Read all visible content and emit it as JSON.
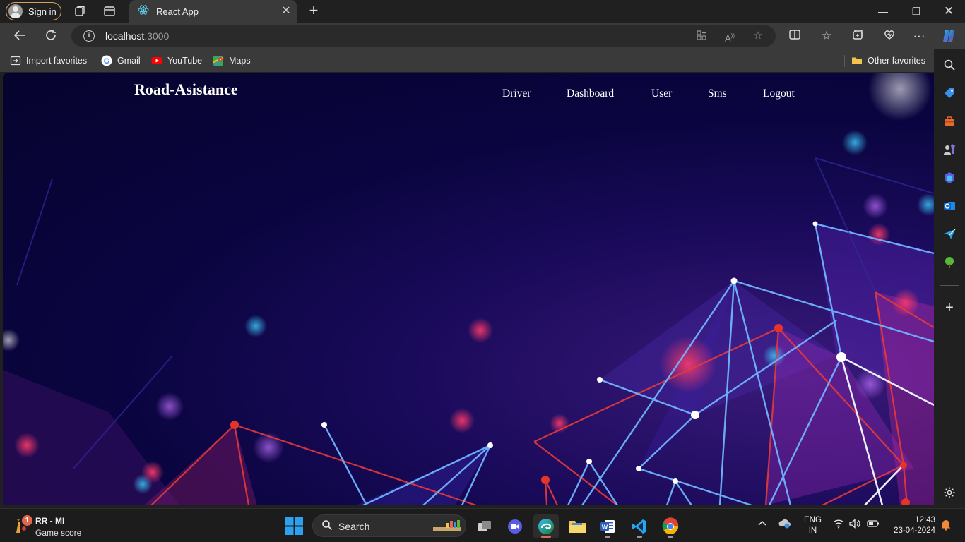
{
  "browser": {
    "signin_label": "Sign in",
    "tab_title": "React App",
    "url_host": "localhost",
    "url_port": ":3000"
  },
  "favorites": {
    "import": "Import favorites",
    "gmail": "Gmail",
    "youtube": "YouTube",
    "maps": "Maps",
    "other": "Other favorites"
  },
  "page": {
    "site_title": "Road-Asistance",
    "nav": [
      {
        "label": "Driver"
      },
      {
        "label": "Dashboard"
      },
      {
        "label": "User"
      },
      {
        "label": "Sms"
      },
      {
        "label": "Logout"
      }
    ]
  },
  "taskbar": {
    "widget_title": "RR - MI",
    "widget_subtitle": "Game score",
    "widget_badge": "1",
    "search_placeholder": "Search",
    "lang_line1": "ENG",
    "lang_line2": "IN",
    "time": "12:43",
    "date": "23-04-2024"
  },
  "colors": {
    "accent_edge": "#2f7bd6",
    "tab_active": "#3a3a3a",
    "page_bg": "#06032e"
  }
}
